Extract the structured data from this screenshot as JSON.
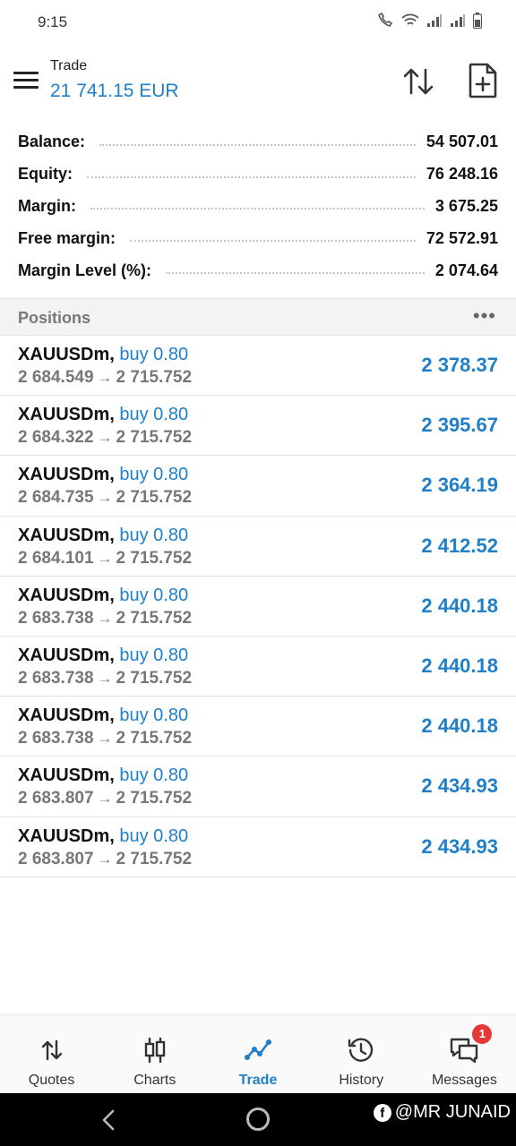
{
  "status_bar": {
    "time": "9:15"
  },
  "header": {
    "title": "Trade",
    "subtitle": "21 741.15 EUR"
  },
  "account": [
    {
      "label": "Balance:",
      "value": "54 507.01"
    },
    {
      "label": "Equity:",
      "value": "76 248.16"
    },
    {
      "label": "Margin:",
      "value": "3 675.25"
    },
    {
      "label": "Free margin:",
      "value": "72 572.91"
    },
    {
      "label": "Margin Level (%):",
      "value": "2 074.64"
    }
  ],
  "positions_header": {
    "title": "Positions",
    "more": "•••"
  },
  "positions": [
    {
      "symbol": "XAUUSDm,",
      "type": "buy 0.80",
      "open": "2 684.549",
      "arrow": "→",
      "current": "2 715.752",
      "profit": "2 378.37"
    },
    {
      "symbol": "XAUUSDm,",
      "type": "buy 0.80",
      "open": "2 684.322",
      "arrow": "→",
      "current": "2 715.752",
      "profit": "2 395.67"
    },
    {
      "symbol": "XAUUSDm,",
      "type": "buy 0.80",
      "open": "2 684.735",
      "arrow": "→",
      "current": "2 715.752",
      "profit": "2 364.19"
    },
    {
      "symbol": "XAUUSDm,",
      "type": "buy 0.80",
      "open": "2 684.101",
      "arrow": "→",
      "current": "2 715.752",
      "profit": "2 412.52"
    },
    {
      "symbol": "XAUUSDm,",
      "type": "buy 0.80",
      "open": "2 683.738",
      "arrow": "→",
      "current": "2 715.752",
      "profit": "2 440.18"
    },
    {
      "symbol": "XAUUSDm,",
      "type": "buy 0.80",
      "open": "2 683.738",
      "arrow": "→",
      "current": "2 715.752",
      "profit": "2 440.18"
    },
    {
      "symbol": "XAUUSDm,",
      "type": "buy 0.80",
      "open": "2 683.738",
      "arrow": "→",
      "current": "2 715.752",
      "profit": "2 440.18"
    },
    {
      "symbol": "XAUUSDm,",
      "type": "buy 0.80",
      "open": "2 683.807",
      "arrow": "→",
      "current": "2 715.752",
      "profit": "2 434.93"
    },
    {
      "symbol": "XAUUSDm,",
      "type": "buy 0.80",
      "open": "2 683.807",
      "arrow": "→",
      "current": "2 715.752",
      "profit": "2 434.93"
    }
  ],
  "bottom_nav": [
    {
      "label": "Quotes",
      "icon": "quotes-icon",
      "active": false
    },
    {
      "label": "Charts",
      "icon": "charts-icon",
      "active": false
    },
    {
      "label": "Trade",
      "icon": "trade-icon",
      "active": true
    },
    {
      "label": "History",
      "icon": "history-icon",
      "active": false
    },
    {
      "label": "Messages",
      "icon": "messages-icon",
      "active": false,
      "badge": "1"
    }
  ],
  "watermark": {
    "text": "@MR JUNAID",
    "icon": "facebook-icon"
  },
  "colors": {
    "accent": "#1f7fc8",
    "badge": "#e53935",
    "muted": "#777777"
  }
}
